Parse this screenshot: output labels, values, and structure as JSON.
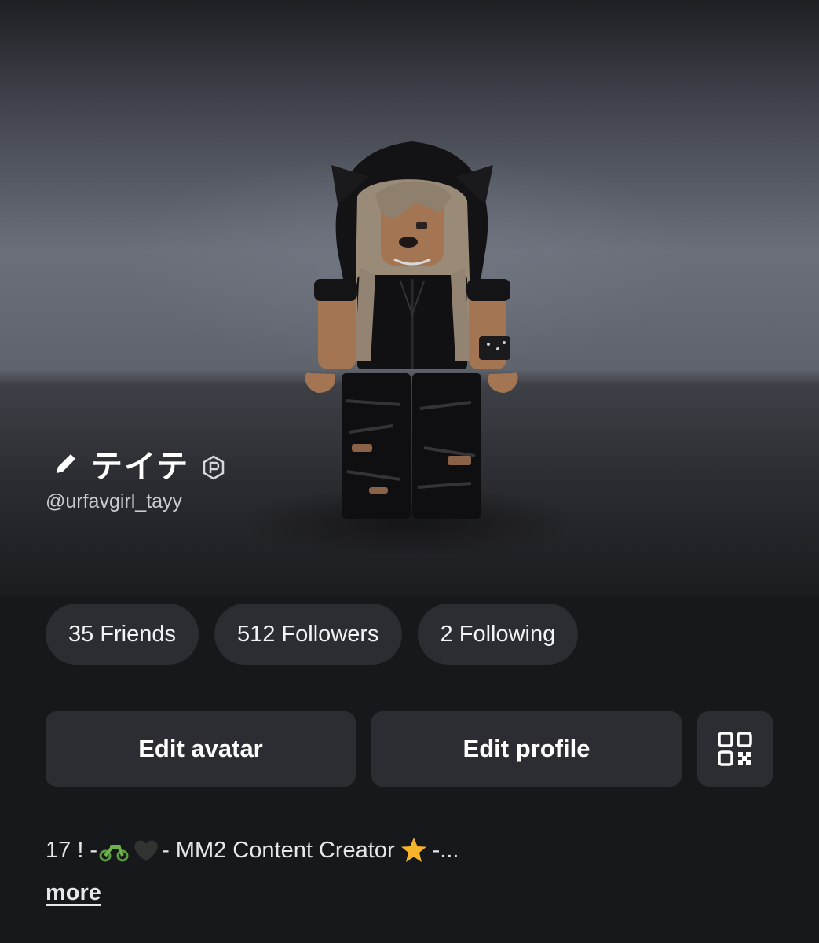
{
  "profile": {
    "display_name": "テイテ",
    "username": "@urfavgirl_tayy"
  },
  "stats": {
    "friends": "35 Friends",
    "followers": "512 Followers",
    "following": "2 Following"
  },
  "actions": {
    "edit_avatar": "Edit avatar",
    "edit_profile": "Edit profile"
  },
  "bio": {
    "prefix": "17 ! - ",
    "middle": " - MM2 Content Creator ",
    "suffix": " -...",
    "more_label": "more"
  },
  "icons": {
    "edit": "pencil-icon",
    "premium": "premium-icon",
    "qr": "qr-code-icon",
    "bio_emojis": [
      "motorcycle-icon",
      "black-heart-icon",
      "star-icon"
    ]
  },
  "colors": {
    "background": "#17181c",
    "pill": "#2c2d32",
    "text": "#f2f3f5",
    "muted": "#c9cbd0",
    "star": "#f5b429",
    "motorcycle": "#6fb34a"
  }
}
